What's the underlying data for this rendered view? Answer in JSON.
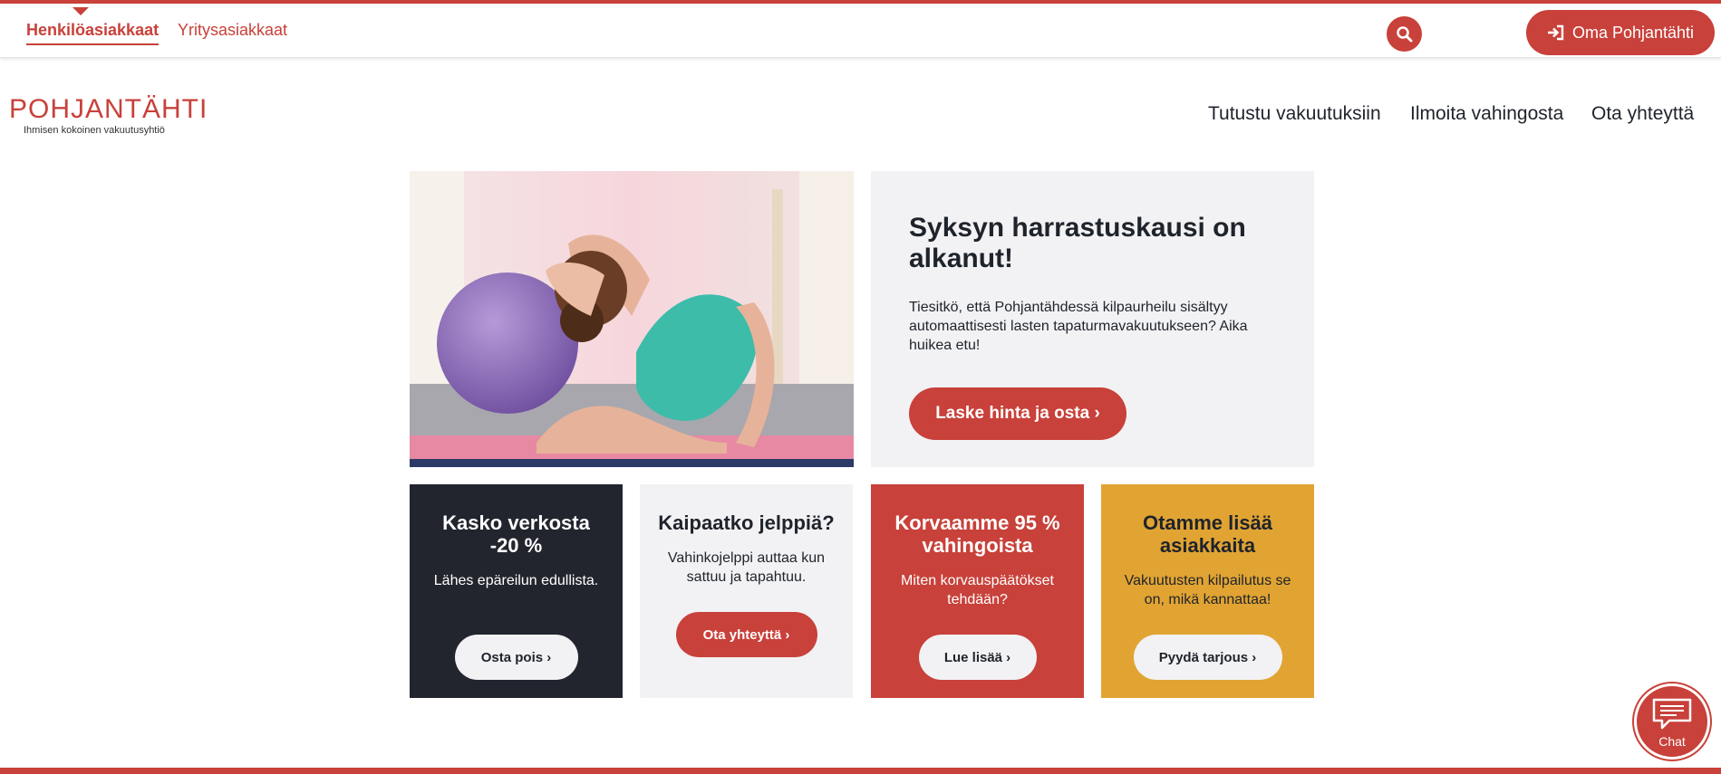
{
  "topnav": {
    "items": [
      {
        "label": "Henkilöasiakkaat",
        "active": true
      },
      {
        "label": "Yritysasiakkaat",
        "active": false
      }
    ],
    "search_icon": "search-icon",
    "login_icon": "sign-in-icon",
    "login_label": "Oma Pohjantähti"
  },
  "logo": {
    "wordmark": "POHJANTÄHTI",
    "tagline": "Ihmisen kokoinen vakuutusyhtiö"
  },
  "mainnav": {
    "items": [
      "Tutustu vakuutuksiin",
      "Ilmoita vahingosta",
      "Ota yhteyttä"
    ]
  },
  "hero": {
    "title": "Syksyn harrastuskausi on alkanut!",
    "text": "Tiesitkö, että Pohjantähdessä kilpaurheilu sisältyy automaattisesti lasten tapaturmavakuutukseen? Aika huikea etu!",
    "button": "Laske hinta ja osta ›"
  },
  "tiles": [
    {
      "title": "Kasko verkosta -20 %",
      "text": "Lähes epäreilun edullista.",
      "button": "Osta pois ›",
      "bg": "#22252e"
    },
    {
      "title": "Kaipaatko jelppiä?",
      "text": "Vahinkojelppi auttaa kun sattuu ja tapahtuu.",
      "button": "Ota yhteyttä ›",
      "bg": "#f2f2f4"
    },
    {
      "title": "Korvaamme 95 % vahingoista",
      "text": "Miten korvauspäätökset tehdään?",
      "button": "Lue lisää ›",
      "bg": "#c8413a"
    },
    {
      "title": "Otamme lisää asiakkaita",
      "text": "Vakuutusten kilpailutus se on, mikä kannattaa!",
      "button": "Pyydä tarjous ›",
      "bg": "#e1a433"
    }
  ],
  "chat": {
    "label": "Chat",
    "icon": "chat-icon"
  },
  "colors": {
    "accent": "#c8413a",
    "dark": "#22252e",
    "yellow": "#e1a433",
    "light": "#f2f2f4"
  }
}
